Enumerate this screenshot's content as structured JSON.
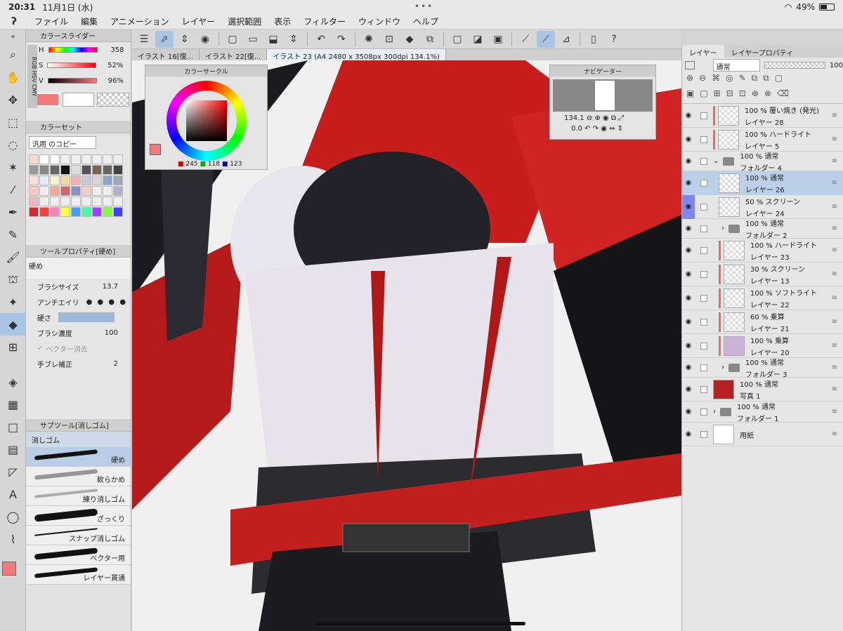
{
  "status": {
    "time": "20:31",
    "date": "11月1日 (水)",
    "battery": "49%"
  },
  "menu": [
    "ファイル",
    "編集",
    "アニメーション",
    "レイヤー",
    "選択範囲",
    "表示",
    "フィルター",
    "ウィンドウ",
    "ヘルプ"
  ],
  "tabs": [
    "イラスト 16[復...",
    "イラスト 22[復...",
    "イラスト 23 (A4 2480 x 3508px 300dpi 134.1%)"
  ],
  "color_slider": {
    "title": "カラースライダー",
    "h": "358",
    "s": "52%",
    "v": "96%"
  },
  "color_set": {
    "title": "カラーセット",
    "preset": "汎用 のコピー"
  },
  "tool_property": {
    "title": "ツールプロパティ[硬め]",
    "name": "硬め",
    "brush_size_label": "ブラシサイズ",
    "brush_size": "13.7",
    "antialias_label": "アンチエイリ",
    "hardness_label": "硬さ",
    "density_label": "ブラシ濃度",
    "density": "100",
    "vector_erase": "ベクター消去",
    "stabilize_label": "手ブレ補正",
    "stabilize": "2"
  },
  "subtool": {
    "title": "サブツール[消しゴム]",
    "group": "消しゴム",
    "items": [
      "硬め",
      "軟らかめ",
      "練り消しゴム",
      "ざっくり",
      "スナップ消しゴム",
      "ベクター用",
      "レイヤー貫通"
    ]
  },
  "color_circle": {
    "title": "カラーサークル",
    "r": "245",
    "g": "118",
    "b": "123"
  },
  "navigator": {
    "title": "ナビゲーター",
    "zoom": "134.1",
    "rotation": "0.0"
  },
  "right": {
    "tab_layer": "レイヤー",
    "tab_prop": "レイヤープロパティ",
    "blend": "通常",
    "opacity": "100"
  },
  "layers": [
    {
      "line1": "100 % 覆い焼き (発光)",
      "line2": "レイヤー 28"
    },
    {
      "line1": "100 % ハードライト",
      "line2": "レイヤー 5"
    },
    {
      "line1": "100 % 通常",
      "line2": "フォルダー 4"
    },
    {
      "line1": "100 % 通常",
      "line2": "レイヤー 26"
    },
    {
      "line1": "50 % スクリーン",
      "line2": "レイヤー 24"
    },
    {
      "line1": "100 % 通常",
      "line2": "フォルダー 2"
    },
    {
      "line1": "100 % ハードライト",
      "line2": "レイヤー 23"
    },
    {
      "line1": "30 % スクリーン",
      "line2": "レイヤー 13"
    },
    {
      "line1": "100 % ソフトライト",
      "line2": "レイヤー 22"
    },
    {
      "line1": "60 % 乗算",
      "line2": "レイヤー 21"
    },
    {
      "line1": "100 % 乗算",
      "line2": "レイヤー 20"
    },
    {
      "line1": "100 % 通常",
      "line2": "フォルダー 3"
    },
    {
      "line1": "100 % 通常",
      "line2": "写真 1"
    },
    {
      "line1": "100 % 通常",
      "line2": "フォルダー 1"
    },
    {
      "line1": "",
      "line2": "用紙"
    }
  ]
}
